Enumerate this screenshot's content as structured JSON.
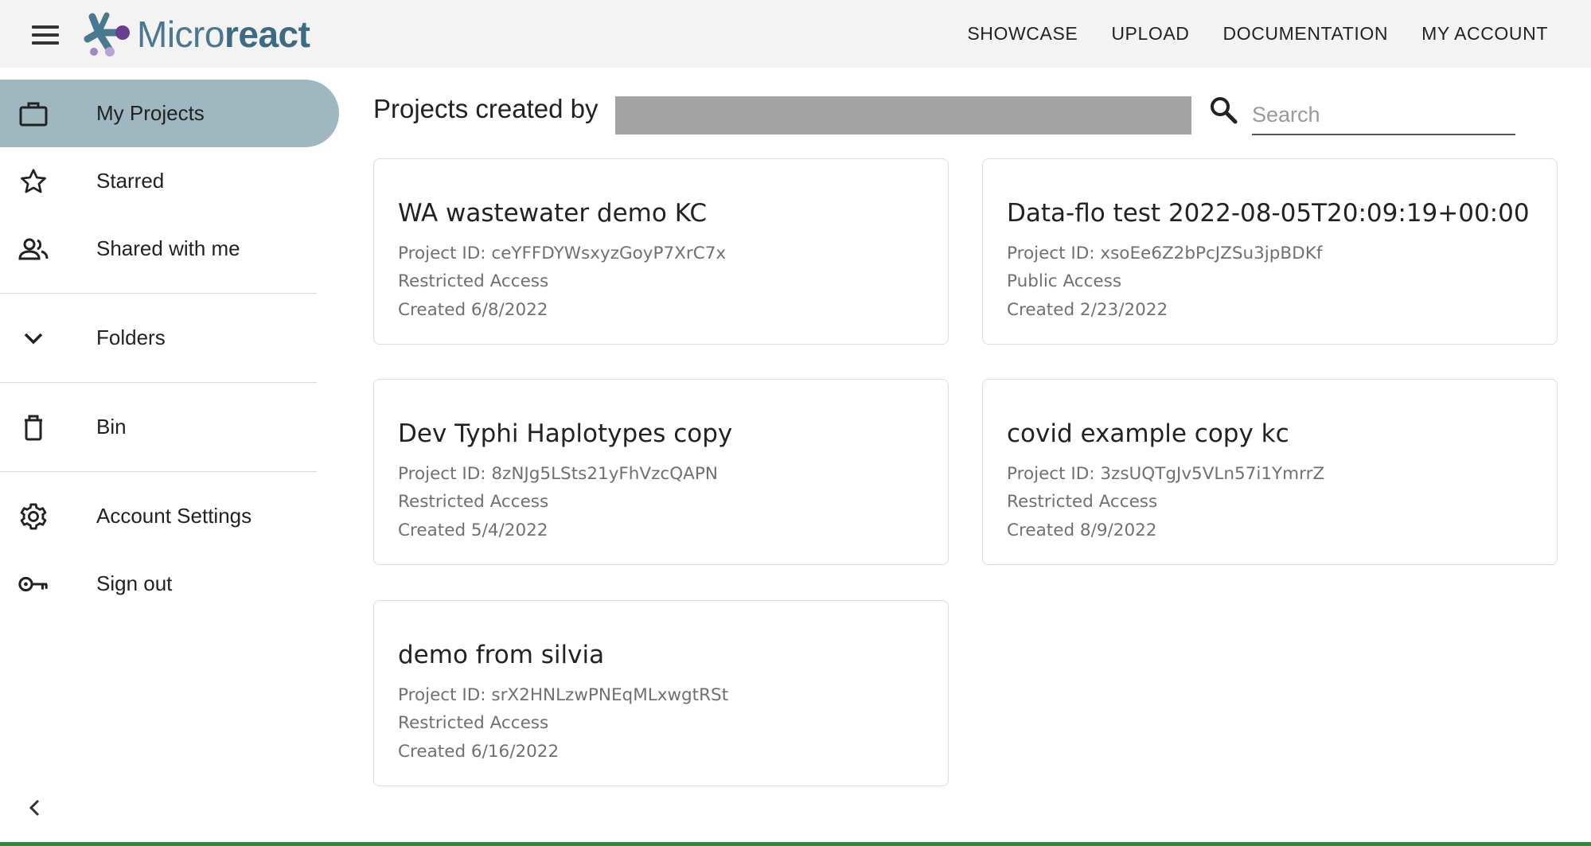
{
  "app": {
    "logo_text_light": "Micro",
    "logo_text_bold": "react"
  },
  "nav": {
    "items": [
      "SHOWCASE",
      "UPLOAD",
      "DOCUMENTATION",
      "MY ACCOUNT"
    ]
  },
  "sidebar": {
    "items": [
      {
        "label": "My Projects",
        "icon": "briefcase-icon",
        "active": true
      },
      {
        "label": "Starred",
        "icon": "star-icon"
      },
      {
        "label": "Shared with me",
        "icon": "people-icon"
      },
      {
        "label": "Folders",
        "icon": "chevron-down-icon"
      },
      {
        "label": "Bin",
        "icon": "trash-icon"
      },
      {
        "label": "Account Settings",
        "icon": "gear-icon"
      },
      {
        "label": "Sign out",
        "icon": "key-icon"
      }
    ],
    "collapse_icon": "chevron-left-icon"
  },
  "main": {
    "title": "Projects created by",
    "search_placeholder": "Search",
    "search_value": "",
    "projects": [
      {
        "name": "WA wastewater demo KC",
        "id": "Project ID: ceYFFDYWsxyzGoyP7XrC7x",
        "access": "Restricted Access",
        "created": "Created 6/8/2022"
      },
      {
        "name": "Data-flo test 2022-08-05T20:09:19+00:00",
        "id": "Project ID: xsoEe6Z2bPcJZSu3jpBDKf",
        "access": "Public Access",
        "created": "Created 2/23/2022"
      },
      {
        "name": "Dev Typhi Haplotypes copy",
        "id": "Project ID: 8zNJg5LSts21yFhVzcQAPN",
        "access": "Restricted Access",
        "created": "Created 5/4/2022"
      },
      {
        "name": "covid example copy kc",
        "id": "Project ID: 3zsUQTgJv5VLn57i1YmrrZ",
        "access": "Restricted Access",
        "created": "Created 8/9/2022"
      },
      {
        "name": "demo from silvia",
        "id": "Project ID: srX2HNLzwPNEqMLxwgtRSt",
        "access": "Restricted Access",
        "created": "Created 6/16/2022"
      }
    ]
  },
  "colors": {
    "topbar_bg": "#f3f3f3",
    "active_item_bg": "#9fb8c0",
    "logo_teal": "#4a7890",
    "logo_purple": "#6a3d8f"
  }
}
